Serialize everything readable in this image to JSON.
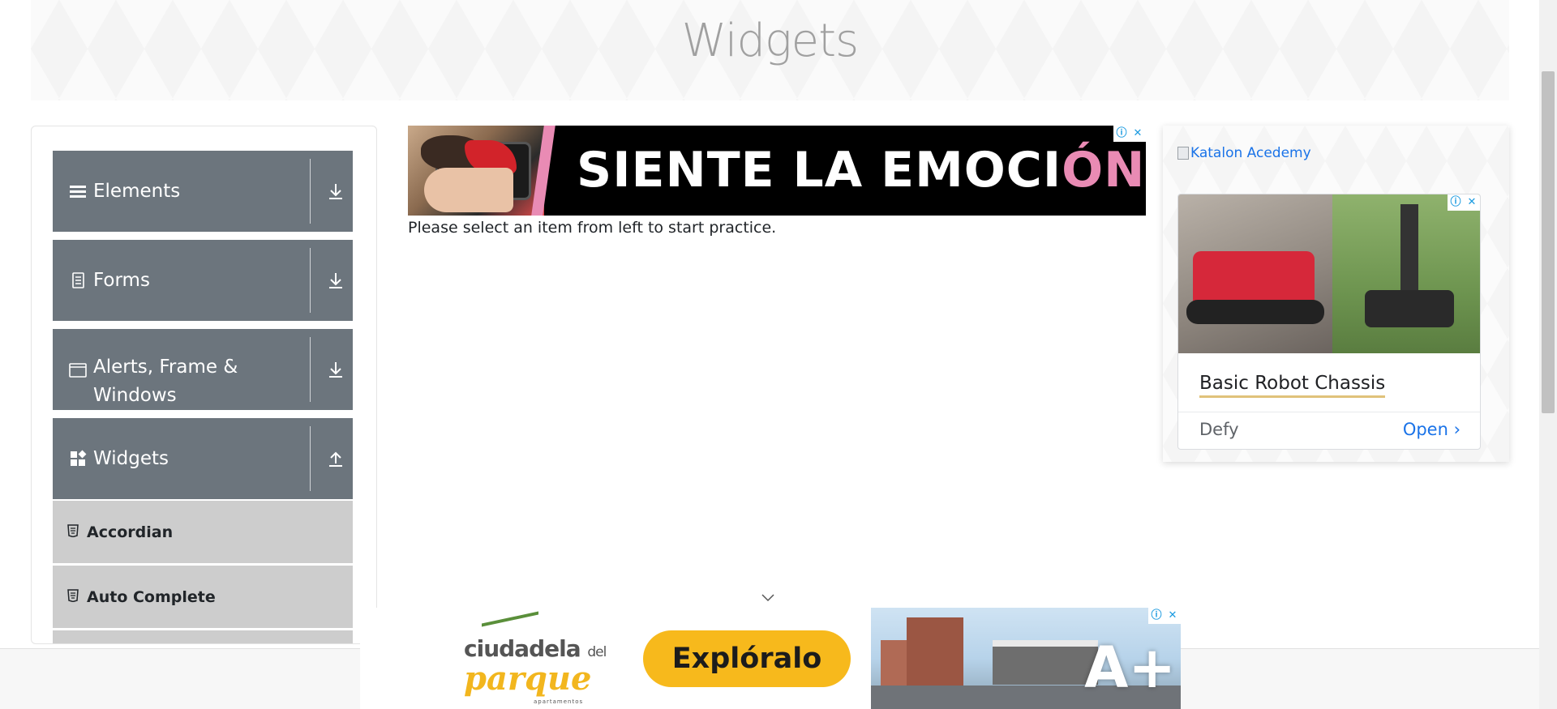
{
  "header": {
    "title": "Widgets"
  },
  "sidebar": {
    "groups": [
      {
        "label": "Elements",
        "icon": "hamburger-icon"
      },
      {
        "label": "Forms",
        "icon": "document-icon"
      },
      {
        "label": "Alerts, Frame & Windows",
        "icon": "window-icon"
      },
      {
        "label": "Widgets",
        "icon": "widgets-icon"
      }
    ],
    "items": [
      {
        "label": "Accordian",
        "icon": "html5-icon"
      },
      {
        "label": "Auto Complete",
        "icon": "html5-icon"
      }
    ]
  },
  "main": {
    "practice_text": "Please select an item from left to start practice."
  },
  "ads": {
    "banner_headline_main": "SIENTE LA EMOCI",
    "banner_headline_accent": "ÓN",
    "katalon_alt": "Katalon Acedemy",
    "robot_title": "Basic Robot Chassis",
    "robot_brand": "Defy",
    "robot_open": "Open",
    "bottom_logo_line1": "ciudadela",
    "bottom_logo_del": "del",
    "bottom_logo_line2": "parque",
    "bottom_logo_line3": "apartamentos",
    "bottom_cta": "Explóralo",
    "bottom_badge": "A+"
  },
  "colors": {
    "sidebar_group_bg": "#6c757d",
    "sidebar_item_bg": "#cdcdcd",
    "link_blue": "#1a73e8",
    "cta_yellow": "#f7b91c",
    "banner_accent_pink": "#e98bb4"
  }
}
